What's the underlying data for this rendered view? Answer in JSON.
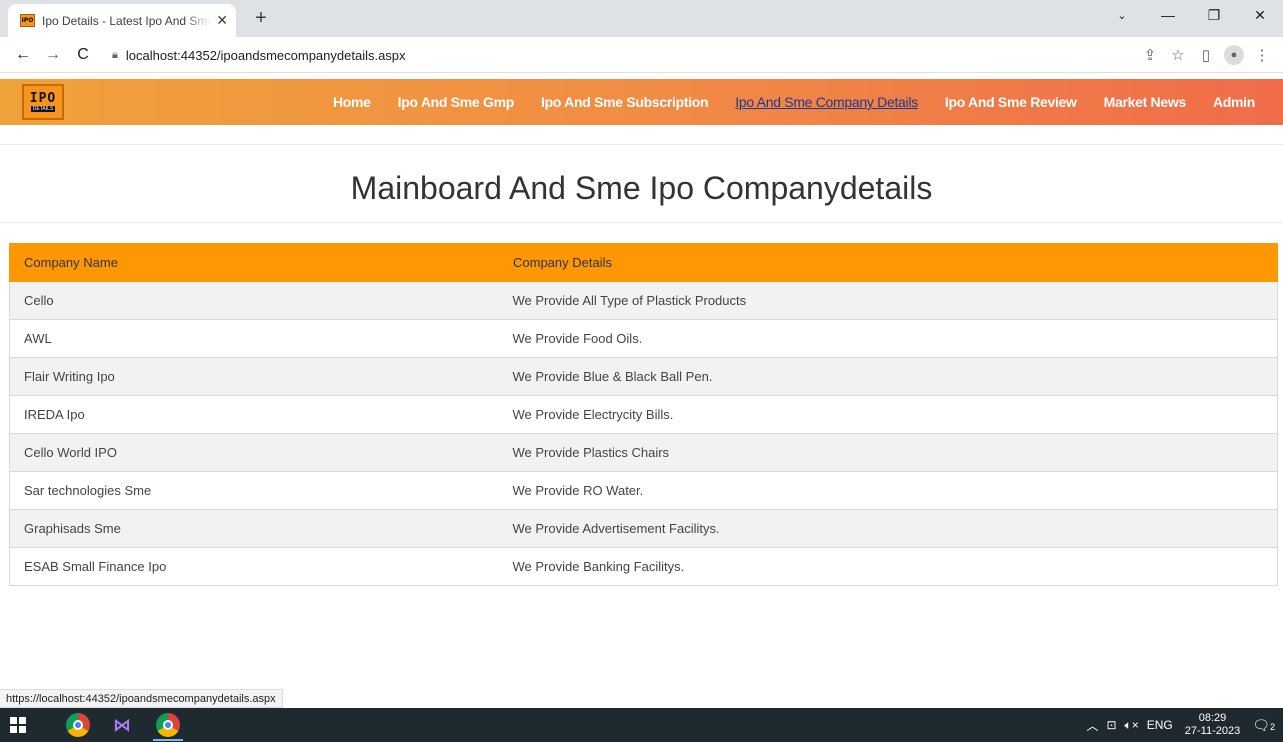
{
  "browser": {
    "tab_title": "Ipo Details - Latest Ipo And Sme Company Details",
    "favicon_text": "IPO",
    "new_tab": "+",
    "url": "localhost:44352/ipoandsmecompanydetails.aspx",
    "status_url": "https://localhost:44352/ipoandsmecompanydetails.aspx"
  },
  "site": {
    "logo": {
      "main": "IPO",
      "sub": "DETAILS"
    },
    "menu": [
      {
        "label": "Home",
        "active": false
      },
      {
        "label": "Ipo And Sme Gmp",
        "active": false
      },
      {
        "label": "Ipo And Sme Subscription",
        "active": false
      },
      {
        "label": "Ipo And Sme Company Details",
        "active": true
      },
      {
        "label": "Ipo And Sme Review",
        "active": false
      },
      {
        "label": "Market News",
        "active": false
      },
      {
        "label": "Admin",
        "active": false
      }
    ]
  },
  "page": {
    "title": "Mainboard And Sme Ipo Companydetails",
    "table": {
      "headers": [
        "Company Name",
        "Company Details"
      ],
      "rows": [
        [
          "Cello",
          "We Provide All Type of Plastick Products"
        ],
        [
          "AWL",
          "We Provide Food Oils."
        ],
        [
          "Flair Writing Ipo",
          "We Provide Blue & Black Ball Pen."
        ],
        [
          "IREDA Ipo",
          "We Provide Electrycity Bills."
        ],
        [
          "Cello World IPO",
          "We Provide Plastics Chairs"
        ],
        [
          "Sar technologies Sme",
          "We Provide RO Water."
        ],
        [
          "Graphisads Sme",
          "We Provide Advertisement Facilitys."
        ],
        [
          "ESAB Small Finance Ipo",
          "We Provide Banking Facilitys."
        ]
      ]
    }
  },
  "taskbar": {
    "apps": [
      "windows-start-icon",
      "chrome-icon",
      "visual-studio-icon",
      "chrome-icon"
    ],
    "language": "ENG",
    "time": "08:29",
    "date": "27-11-2023",
    "notification_count": "2"
  },
  "colors": {
    "nav_gradient_start": "#f0a23b",
    "nav_gradient_end": "#f06c49",
    "table_header": "#fd9802",
    "active_link": "#1f3a93"
  }
}
